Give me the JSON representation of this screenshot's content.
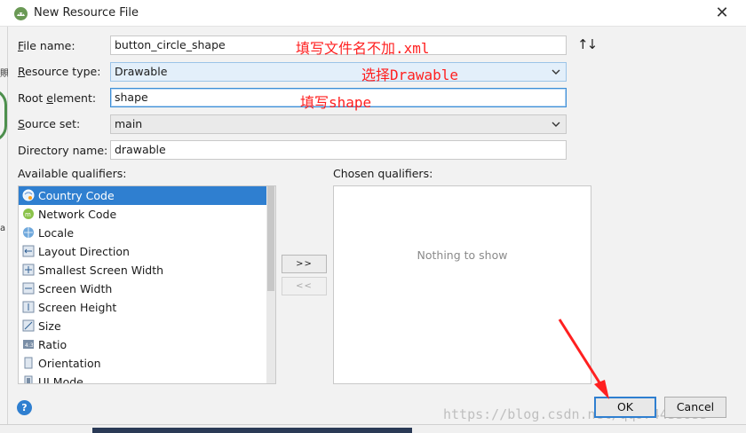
{
  "window": {
    "title": "New Resource File",
    "close_glyph": "✕"
  },
  "form": {
    "file_name": {
      "label": "File name:",
      "mnemonic": "F",
      "value": "button_circle_shape"
    },
    "resource_type": {
      "label": "Resource type:",
      "mnemonic": "R",
      "value": "Drawable"
    },
    "root_element": {
      "label": "Root element:",
      "mnemonic": "e",
      "value": "shape"
    },
    "source_set": {
      "label": "Source set:",
      "mnemonic": "S",
      "value": "main"
    },
    "directory_name": {
      "label": "Directory name:",
      "value": "drawable"
    }
  },
  "annotations": {
    "file_name_note": "填写文件名不加.xml",
    "resource_type_note": "选择Drawable",
    "root_element_note": "填写shape"
  },
  "qualifiers": {
    "available_label": "Available qualifiers:",
    "chosen_label": "Chosen qualifiers:",
    "empty_text": "Nothing to show",
    "add_button": ">>",
    "remove_button": "<<",
    "items": [
      {
        "label": "Country Code",
        "icon": "globe-country-icon",
        "selected": true
      },
      {
        "label": "Network Code",
        "icon": "network-code-icon",
        "selected": false
      },
      {
        "label": "Locale",
        "icon": "locale-globe-icon",
        "selected": false
      },
      {
        "label": "Layout Direction",
        "icon": "layout-direction-icon",
        "selected": false
      },
      {
        "label": "Smallest Screen Width",
        "icon": "smallest-width-icon",
        "selected": false
      },
      {
        "label": "Screen Width",
        "icon": "screen-width-icon",
        "selected": false
      },
      {
        "label": "Screen Height",
        "icon": "screen-height-icon",
        "selected": false
      },
      {
        "label": "Size",
        "icon": "size-icon",
        "selected": false
      },
      {
        "label": "Ratio",
        "icon": "ratio-icon",
        "selected": false
      },
      {
        "label": "Orientation",
        "icon": "orientation-icon",
        "selected": false
      },
      {
        "label": "UI Mode",
        "icon": "ui-mode-icon",
        "selected": false
      }
    ]
  },
  "buttons": {
    "ok": "OK",
    "cancel": "Cancel",
    "help": "?"
  },
  "watermark": "https://blog.csdn.net/qq974433953",
  "colors": {
    "accent": "#2f7fd0",
    "annotation": "#ff2020",
    "background": "#f2f2f2"
  }
}
